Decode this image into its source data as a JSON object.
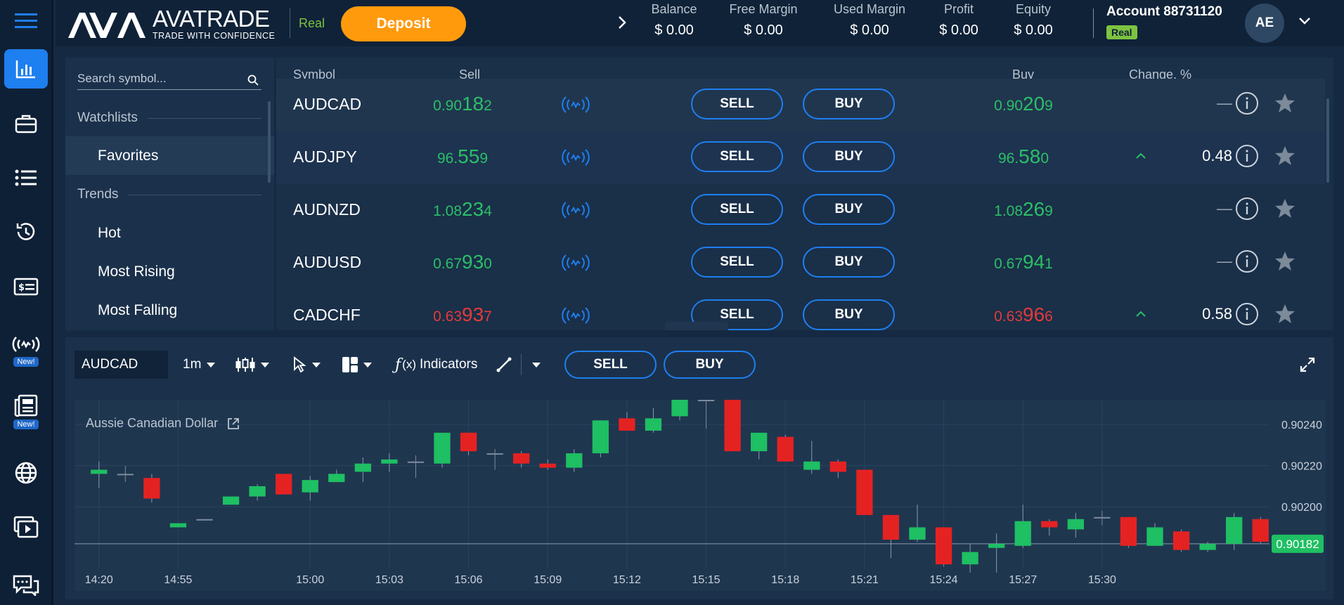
{
  "rail": {
    "items": [
      {
        "icon": "chart-icon",
        "active": true
      },
      {
        "icon": "briefcase-icon"
      },
      {
        "icon": "list-icon"
      },
      {
        "icon": "history-icon"
      },
      {
        "icon": "dollar-card-icon"
      },
      {
        "icon": "signal-icon",
        "badge": "New!"
      },
      {
        "icon": "news-icon",
        "badge": "New!"
      },
      {
        "icon": "globe-icon"
      },
      {
        "icon": "video-icon"
      },
      {
        "icon": "chat-icon"
      }
    ]
  },
  "header": {
    "logo_name": "AVATRADE",
    "logo_tagline": "TRADE WITH CONFIDENCE",
    "mode": "Real",
    "deposit_label": "Deposit",
    "stats": [
      {
        "label": "Balance",
        "value": "$ 0.00"
      },
      {
        "label": "Free Margin",
        "value": "$ 0.00"
      },
      {
        "label": "Used Margin",
        "value": "$ 0.00"
      },
      {
        "label": "Profit",
        "value": "$ 0.00"
      },
      {
        "label": "Equity",
        "value": "$ 0.00"
      }
    ],
    "account": "Account 88731120",
    "account_badge": "Real",
    "avatar": "AE"
  },
  "sidebar": {
    "search_placeholder": "Search symbol...",
    "watchlists_heading": "Watchlists",
    "watchlist_items": [
      "Favorites"
    ],
    "trends_heading": "Trends",
    "trend_items": [
      "Hot",
      "Most Rising",
      "Most Falling"
    ]
  },
  "market": {
    "columns": {
      "symbol": "Symbol",
      "sell": "Sell",
      "buy": "Buy",
      "change": "Change, %"
    },
    "sell_label": "SELL",
    "buy_label": "BUY",
    "rows": [
      {
        "symbol": "AUDCAD",
        "sell_small": "0.90",
        "sell_big": "18",
        "sell_tail": "2",
        "buy_small": "0.90",
        "buy_big": "20",
        "buy_tail": "9",
        "change": "—",
        "change_dir": "none",
        "color": "green"
      },
      {
        "symbol": "AUDJPY",
        "sell_small": "96.",
        "sell_big": "55",
        "sell_tail": "9",
        "buy_small": "96.",
        "buy_big": "58",
        "buy_tail": "0",
        "change": "0.48",
        "change_dir": "up",
        "color": "green"
      },
      {
        "symbol": "AUDNZD",
        "sell_small": "1.08",
        "sell_big": "23",
        "sell_tail": "4",
        "buy_small": "1.08",
        "buy_big": "26",
        "buy_tail": "9",
        "change": "—",
        "change_dir": "none",
        "color": "green"
      },
      {
        "symbol": "AUDUSD",
        "sell_small": "0.67",
        "sell_big": "93",
        "sell_tail": "0",
        "buy_small": "0.67",
        "buy_big": "94",
        "buy_tail": "1",
        "change": "—",
        "change_dir": "none",
        "color": "green"
      },
      {
        "symbol": "CADCHF",
        "sell_small": "0.63",
        "sell_big": "93",
        "sell_tail": "7",
        "buy_small": "0.63",
        "buy_big": "96",
        "buy_tail": "6",
        "change": "0.58",
        "change_dir": "up",
        "color": "red"
      }
    ]
  },
  "chart_toolbar": {
    "symbol": "AUDCAD",
    "timeframe": "1m",
    "indicators_label": "Indicators",
    "sell_label": "SELL",
    "buy_label": "BUY"
  },
  "chart_data": {
    "type": "candlestick",
    "title": "Aussie Canadian Dollar",
    "ylim": [
      0.9017,
      0.90252
    ],
    "y_ticks": [
      "0.90240",
      "0.90220",
      "0.90200"
    ],
    "y_tick_values": [
      0.9024,
      0.9022,
      0.902
    ],
    "current_price": "0.90182",
    "current_value": 0.90182,
    "x_tick_labels": [
      "14:20",
      "14:55",
      "15:00",
      "15:03",
      "15:06",
      "15:09",
      "15:12",
      "15:15",
      "15:18",
      "15:21",
      "15:24",
      "15:27",
      "15:30"
    ],
    "candles": [
      {
        "o": 0.90216,
        "c": 0.90218,
        "h": 0.90222,
        "l": 0.90209
      },
      {
        "o": 0.90216,
        "c": 0.90216,
        "h": 0.9022,
        "l": 0.90212
      },
      {
        "o": 0.90214,
        "c": 0.90204,
        "h": 0.90216,
        "l": 0.90202
      },
      {
        "o": 0.9019,
        "c": 0.90192,
        "h": 0.90192,
        "l": 0.9019
      },
      {
        "o": 0.90194,
        "c": 0.90194,
        "h": 0.90194,
        "l": 0.90194
      },
      {
        "o": 0.90201,
        "c": 0.90205,
        "h": 0.90205,
        "l": 0.90201
      },
      {
        "o": 0.90205,
        "c": 0.9021,
        "h": 0.90211,
        "l": 0.90203
      },
      {
        "o": 0.90216,
        "c": 0.90206,
        "h": 0.90216,
        "l": 0.90206
      },
      {
        "o": 0.90207,
        "c": 0.90213,
        "h": 0.90215,
        "l": 0.90203
      },
      {
        "o": 0.90212,
        "c": 0.90216,
        "h": 0.90218,
        "l": 0.90212
      },
      {
        "o": 0.90217,
        "c": 0.90221,
        "h": 0.90224,
        "l": 0.90212
      },
      {
        "o": 0.90221,
        "c": 0.90223,
        "h": 0.90226,
        "l": 0.90217
      },
      {
        "o": 0.90222,
        "c": 0.90222,
        "h": 0.90225,
        "l": 0.90214
      },
      {
        "o": 0.90221,
        "c": 0.90236,
        "h": 0.90236,
        "l": 0.90219
      },
      {
        "o": 0.90236,
        "c": 0.90227,
        "h": 0.90236,
        "l": 0.90225
      },
      {
        "o": 0.90226,
        "c": 0.90226,
        "h": 0.90228,
        "l": 0.90218
      },
      {
        "o": 0.90226,
        "c": 0.90221,
        "h": 0.90227,
        "l": 0.90219
      },
      {
        "o": 0.90221,
        "c": 0.90219,
        "h": 0.90223,
        "l": 0.90218
      },
      {
        "o": 0.90219,
        "c": 0.90226,
        "h": 0.90228,
        "l": 0.90217
      },
      {
        "o": 0.90226,
        "c": 0.90242,
        "h": 0.90242,
        "l": 0.90224
      },
      {
        "o": 0.90243,
        "c": 0.90237,
        "h": 0.90246,
        "l": 0.90237
      },
      {
        "o": 0.90237,
        "c": 0.90243,
        "h": 0.90248,
        "l": 0.90236
      },
      {
        "o": 0.90244,
        "c": 0.90252,
        "h": 0.9026,
        "l": 0.90242
      },
      {
        "o": 0.90252,
        "c": 0.90252,
        "h": 0.90252,
        "l": 0.90238
      },
      {
        "o": 0.90252,
        "c": 0.90227,
        "h": 0.90255,
        "l": 0.90227
      },
      {
        "o": 0.90227,
        "c": 0.90236,
        "h": 0.90236,
        "l": 0.90223
      },
      {
        "o": 0.90234,
        "c": 0.90222,
        "h": 0.90235,
        "l": 0.90222
      },
      {
        "o": 0.90218,
        "c": 0.90222,
        "h": 0.90232,
        "l": 0.90216
      },
      {
        "o": 0.90222,
        "c": 0.90217,
        "h": 0.90223,
        "l": 0.90214
      },
      {
        "o": 0.90218,
        "c": 0.90196,
        "h": 0.90218,
        "l": 0.90196
      },
      {
        "o": 0.90196,
        "c": 0.90184,
        "h": 0.90196,
        "l": 0.90175
      },
      {
        "o": 0.90184,
        "c": 0.9019,
        "h": 0.90201,
        "l": 0.90183
      },
      {
        "o": 0.9019,
        "c": 0.90172,
        "h": 0.9019,
        "l": 0.90171
      },
      {
        "o": 0.90172,
        "c": 0.90178,
        "h": 0.90182,
        "l": 0.90168
      },
      {
        "o": 0.9018,
        "c": 0.90182,
        "h": 0.90187,
        "l": 0.90168
      },
      {
        "o": 0.90181,
        "c": 0.90193,
        "h": 0.90201,
        "l": 0.9018
      },
      {
        "o": 0.90193,
        "c": 0.9019,
        "h": 0.90194,
        "l": 0.90186
      },
      {
        "o": 0.90189,
        "c": 0.90194,
        "h": 0.90197,
        "l": 0.90185
      },
      {
        "o": 0.90195,
        "c": 0.90195,
        "h": 0.90198,
        "l": 0.90191
      },
      {
        "o": 0.90195,
        "c": 0.90181,
        "h": 0.90195,
        "l": 0.9018
      },
      {
        "o": 0.90181,
        "c": 0.9019,
        "h": 0.90192,
        "l": 0.90181
      },
      {
        "o": 0.90188,
        "c": 0.90179,
        "h": 0.90189,
        "l": 0.90178
      },
      {
        "o": 0.90179,
        "c": 0.90182,
        "h": 0.90183,
        "l": 0.90178
      },
      {
        "o": 0.90182,
        "c": 0.90195,
        "h": 0.90197,
        "l": 0.90179
      },
      {
        "o": 0.90194,
        "c": 0.90183,
        "h": 0.90195,
        "l": 0.90182
      }
    ],
    "up_color": "#1fbf63",
    "down_color": "#e52222"
  }
}
